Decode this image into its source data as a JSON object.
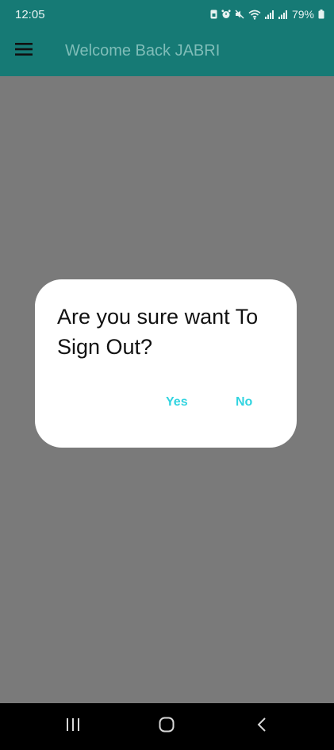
{
  "status_bar": {
    "time": "12:05",
    "battery_percent": "79%",
    "icons": [
      "sim-icon",
      "alarm-icon",
      "mute-icon",
      "wifi-icon",
      "signal-icon",
      "signal-icon",
      "battery-icon"
    ]
  },
  "app_bar": {
    "title": "Welcome Back JABRI",
    "menu_icon": "hamburger-menu-icon"
  },
  "dialog": {
    "message": "Are you sure want To Sign Out?",
    "yes_label": "Yes",
    "no_label": "No"
  },
  "nav_bar": {
    "recents_icon": "recents-icon",
    "home_icon": "home-icon",
    "back_icon": "back-icon"
  },
  "colors": {
    "primary": "#167a75",
    "scrim": "#7a7a7a",
    "dialog_button": "#32d4e0",
    "title_text": "#7fbdb8"
  }
}
